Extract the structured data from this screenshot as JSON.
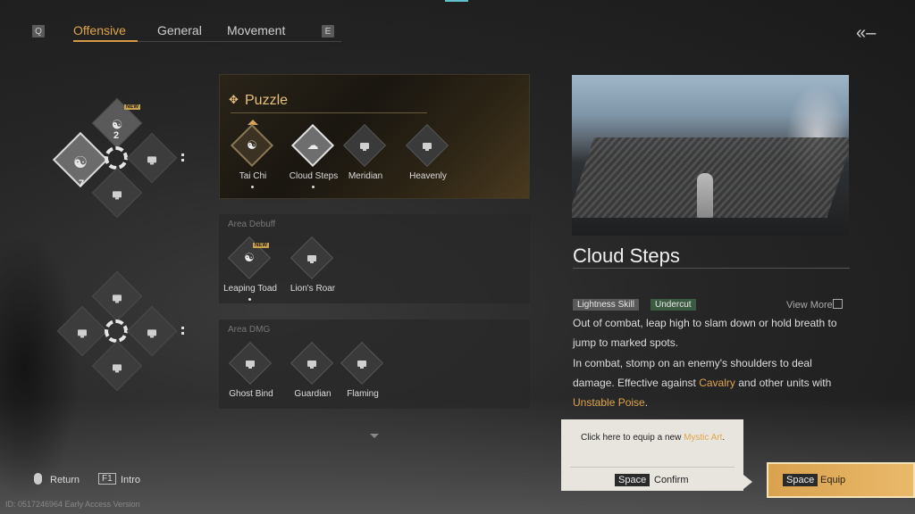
{
  "tabs": {
    "prev_key": "Q",
    "next_key": "E",
    "items": [
      "Offensive",
      "General",
      "Movement"
    ],
    "active": "Offensive"
  },
  "left_wheel": {
    "top_new": "NEW",
    "top_count": "2",
    "selected_count": "7"
  },
  "puzzle": {
    "title": "Puzzle",
    "skills": [
      {
        "label": "Tai Chi"
      },
      {
        "label": "Cloud Steps"
      },
      {
        "label": "Meridian"
      },
      {
        "label": "Heavenly"
      }
    ]
  },
  "area_debuff": {
    "title": "Area Debuff",
    "skills": [
      {
        "label": "Leaping Toad",
        "badge": "NEW"
      },
      {
        "label": "Lion's Roar"
      }
    ]
  },
  "area_dmg": {
    "title": "Area DMG",
    "skills": [
      {
        "label": "Ghost Bind"
      },
      {
        "label": "Guardian"
      },
      {
        "label": "Flaming"
      }
    ]
  },
  "detail": {
    "title": "Cloud Steps",
    "tags": [
      "Lightness Skill",
      "Undercut"
    ],
    "view_more": "View More",
    "desc1": "Out of combat, leap high to slam down or hold breath to jump to marked spots.",
    "desc2_a": "In combat, stomp on an enemy's shoulders to deal damage. Effective against ",
    "desc2_hl1": "Cavalry",
    "desc2_b": " and other units with ",
    "desc2_hl2": "Unstable Poise",
    "desc2_c": "."
  },
  "tooltip": {
    "text_a": "Click here to equip a new ",
    "text_hl": "Mystic Art",
    "text_b": ".",
    "key": "Space",
    "confirm": "Confirm"
  },
  "equip": {
    "key": "Space",
    "label": "Equip"
  },
  "footer": {
    "return": "Return",
    "intro_key": "F1",
    "intro": "Intro",
    "version": "ID: 0517246964 Early Access Version"
  },
  "colors": {
    "accent": "#e0a54a",
    "undercut_tag": "#3b5a42"
  }
}
